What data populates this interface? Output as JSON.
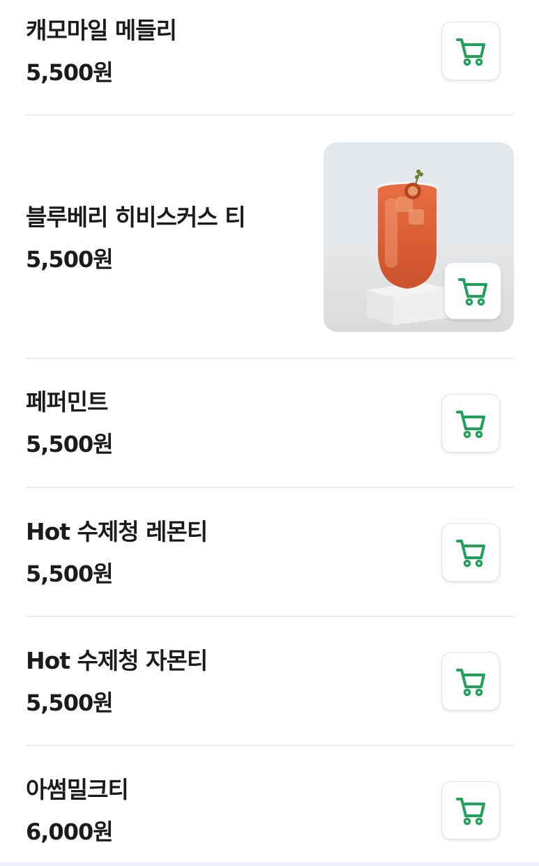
{
  "menu": {
    "items": [
      {
        "name": "캐모마일 메들리",
        "price": "5,500원",
        "cart_icon": "cart-icon",
        "has_image": false
      },
      {
        "name": "블루베리 히비스커스 티",
        "price": "5,500원",
        "cart_icon": "cart-icon",
        "has_image": true,
        "image_subject": "iced hibiscus tea glass"
      },
      {
        "name": "페퍼민트",
        "price": "5,500원",
        "cart_icon": "cart-icon",
        "has_image": false
      },
      {
        "name": "Hot 수제청 레몬티",
        "price": "5,500원",
        "cart_icon": "cart-icon",
        "has_image": false
      },
      {
        "name": "Hot 수제청 자몬티",
        "price": "5,500원",
        "cart_icon": "cart-icon",
        "has_image": false
      },
      {
        "name": "아썸밀크티",
        "price": "6,000원",
        "cart_icon": "cart-icon",
        "has_image": false
      }
    ]
  },
  "colors": {
    "accent": "#1fa15a",
    "text": "#1b1b1b",
    "divider": "#ececec"
  }
}
